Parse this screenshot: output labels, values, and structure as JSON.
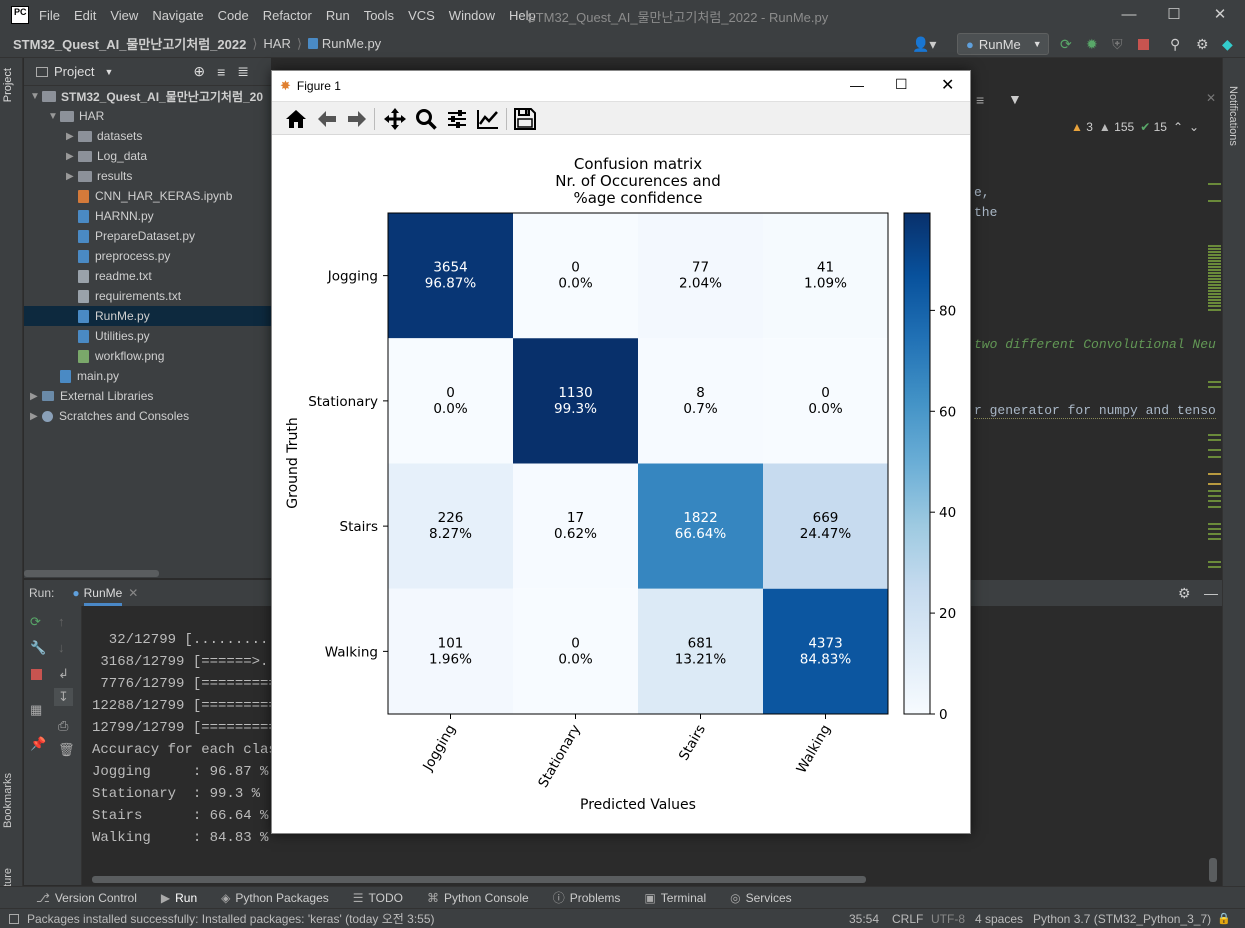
{
  "app": {
    "logo": "PC",
    "menu": [
      "File",
      "Edit",
      "View",
      "Navigate",
      "Code",
      "Refactor",
      "Run",
      "Tools",
      "VCS",
      "Window",
      "Help"
    ],
    "window_title": "STM32_Quest_AI_물만난고기처럼_2022 - RunMe.py"
  },
  "navbar": {
    "crumbs": [
      "STM32_Quest_AI_물만난고기처럼_2022",
      "HAR",
      "RunMe.py"
    ],
    "run_config": "RunMe"
  },
  "sidebar": {
    "project_tab": "Project",
    "bookmarks_tab": "Bookmarks",
    "structure_tab": "Structure",
    "notifications_tab": "Notifications"
  },
  "project": {
    "header": "Project",
    "root": "STM32_Quest_AI_물만난고기처럼_20",
    "items": [
      {
        "label": "HAR",
        "type": "folder",
        "depth": 1,
        "expanded": true
      },
      {
        "label": "datasets",
        "type": "folder",
        "depth": 2
      },
      {
        "label": "Log_data",
        "type": "folder",
        "depth": 2
      },
      {
        "label": "results",
        "type": "folder",
        "depth": 2
      },
      {
        "label": "CNN_HAR_KERAS.ipynb",
        "type": "file",
        "depth": 2
      },
      {
        "label": "HARNN.py",
        "type": "file",
        "depth": 2
      },
      {
        "label": "PrepareDataset.py",
        "type": "file",
        "depth": 2
      },
      {
        "label": "preprocess.py",
        "type": "file",
        "depth": 2
      },
      {
        "label": "readme.txt",
        "type": "file",
        "depth": 2
      },
      {
        "label": "requirements.txt",
        "type": "file",
        "depth": 2
      },
      {
        "label": "RunMe.py",
        "type": "file",
        "depth": 2,
        "selected": true
      },
      {
        "label": "Utilities.py",
        "type": "file",
        "depth": 2
      },
      {
        "label": "workflow.png",
        "type": "file",
        "depth": 2
      },
      {
        "label": "main.py",
        "type": "file",
        "depth": 1
      },
      {
        "label": "External Libraries",
        "type": "lib",
        "depth": 0
      },
      {
        "label": "Scratches and Consoles",
        "type": "scratch",
        "depth": 0
      }
    ]
  },
  "editor": {
    "inspections": {
      "errors": "3",
      "warnings": "155",
      "ok": "15"
    },
    "fragments": [
      {
        "text": "e,",
        "kind": "code"
      },
      {
        "text": "the",
        "kind": "code"
      },
      {
        "text": "two different Convolutional Neu",
        "kind": "comment"
      },
      {
        "text": "r generator for numpy and tenso",
        "kind": "code"
      }
    ]
  },
  "run": {
    "label": "Run:",
    "tab": "RunMe",
    "lines": [
      "  32/12799 [.........",
      " 3168/12799 [======>..",
      " 7776/12799 [=========",
      "12288/12799 [=========",
      "12799/12799 [=========",
      "Accuracy for each class",
      "Jogging     : 96.87 %",
      "Stationary  : 99.3 %",
      "Stairs      : 66.64 %",
      "Walking     : 84.83 %"
    ]
  },
  "bottom_tabs": [
    "Version Control",
    "Run",
    "Python Packages",
    "TODO",
    "Python Console",
    "Problems",
    "Terminal",
    "Services"
  ],
  "status": {
    "message": "Packages installed successfully: Installed packages: 'keras' (today 오전 3:55)",
    "position": "35:54",
    "line_sep": "CRLF",
    "encoding": "UTF-8",
    "indent": "4 spaces",
    "interpreter": "Python 3.7 (STM32_Python_3_7)"
  },
  "figure": {
    "title": "Figure 1"
  },
  "chart_data": {
    "type": "heatmap",
    "title_lines": [
      "Confusion matrix",
      "Nr. of Occurences and",
      "%age confidence"
    ],
    "xlabel": "Predicted Values",
    "ylabel": "Ground Truth",
    "rows": [
      "Jogging",
      "Stationary",
      "Stairs",
      "Walking"
    ],
    "cols": [
      "Jogging",
      "Stationary",
      "Stairs",
      "Walking"
    ],
    "counts": [
      [
        3654,
        0,
        77,
        41
      ],
      [
        0,
        1130,
        8,
        0
      ],
      [
        226,
        17,
        1822,
        669
      ],
      [
        101,
        0,
        681,
        4373
      ]
    ],
    "percent_labels": [
      [
        "96.87%",
        "0.0%",
        "2.04%",
        "1.09%"
      ],
      [
        "0.0%",
        "99.3%",
        "0.7%",
        "0.0%"
      ],
      [
        "8.27%",
        "0.62%",
        "66.64%",
        "24.47%"
      ],
      [
        "1.96%",
        "0.0%",
        "13.21%",
        "84.83%"
      ]
    ],
    "values": [
      [
        96.87,
        0,
        2.04,
        1.09
      ],
      [
        0,
        99.3,
        0.7,
        0
      ],
      [
        8.27,
        0.62,
        66.64,
        24.47
      ],
      [
        1.96,
        0,
        13.21,
        84.83
      ]
    ],
    "colorbar": {
      "min": 0,
      "max": 99.3,
      "ticks": [
        0,
        20,
        40,
        60,
        80
      ],
      "colormap": "Blues"
    }
  }
}
